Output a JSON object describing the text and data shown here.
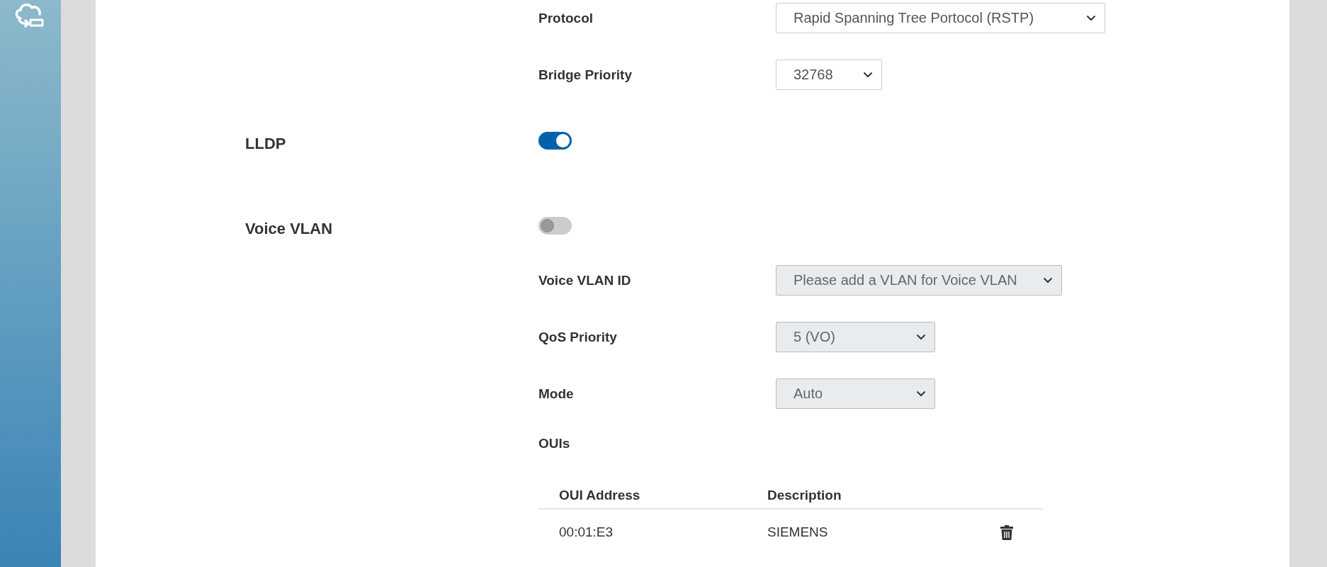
{
  "spanning_tree": {
    "fields": [
      {
        "label": "Protocol",
        "value": "Rapid Spanning Tree Portocol (RSTP)",
        "disabled": false
      },
      {
        "label": "Bridge Priority",
        "value": "32768",
        "disabled": false
      }
    ]
  },
  "lldp": {
    "title": "LLDP",
    "on": true
  },
  "voice_vlan": {
    "title": "Voice VLAN",
    "on": false,
    "fields": [
      {
        "label": "Voice VLAN ID",
        "value": "Please add a VLAN for Voice VLAN",
        "disabled": true
      },
      {
        "label": "QoS Priority",
        "value": "5 (VO)",
        "disabled": true
      },
      {
        "label": "Mode",
        "value": "Auto",
        "disabled": true
      }
    ],
    "ouis": {
      "title": "OUIs",
      "columns": [
        "OUI Address",
        "Description"
      ],
      "rows": [
        {
          "oui_address": "00:01:E3",
          "description": "SIEMENS"
        }
      ]
    }
  }
}
